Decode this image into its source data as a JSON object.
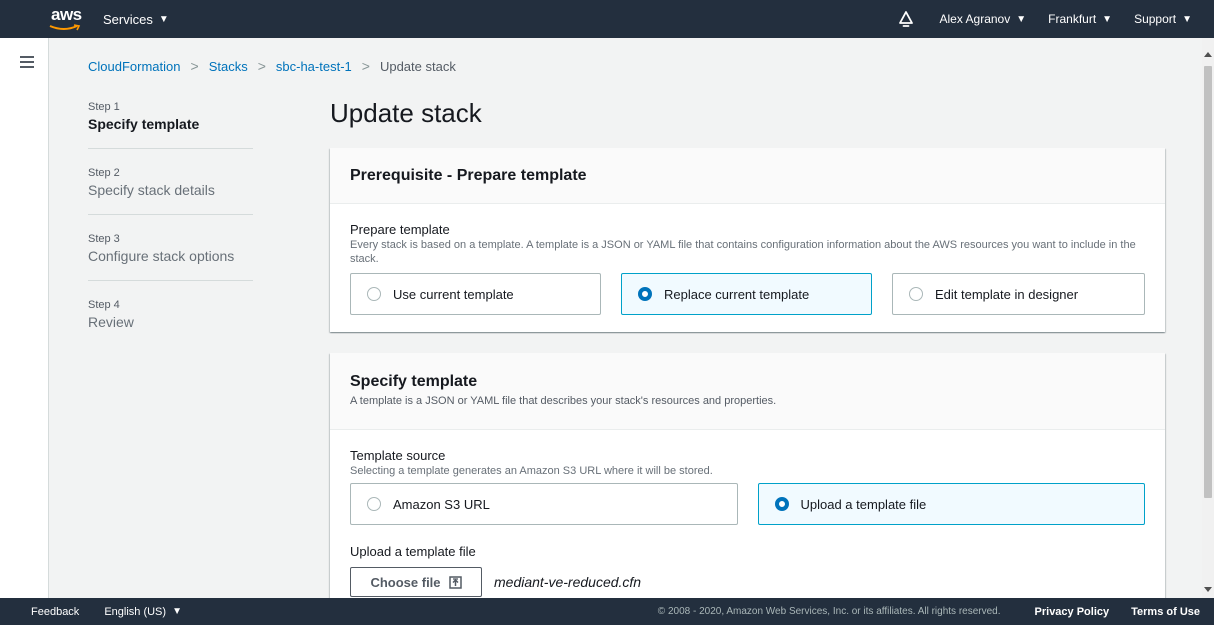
{
  "topnav": {
    "logo_text": "aws",
    "services_label": "Services",
    "user_label": "Alex Agranov",
    "region_label": "Frankfurt",
    "support_label": "Support"
  },
  "breadcrumb": {
    "items": [
      "CloudFormation",
      "Stacks",
      "sbc-ha-test-1"
    ],
    "current": "Update stack"
  },
  "steps": [
    {
      "num": "Step 1",
      "title": "Specify template"
    },
    {
      "num": "Step 2",
      "title": "Specify stack details"
    },
    {
      "num": "Step 3",
      "title": "Configure stack options"
    },
    {
      "num": "Step 4",
      "title": "Review"
    }
  ],
  "page_title": "Update stack",
  "prerequisite": {
    "heading": "Prerequisite - Prepare template",
    "label": "Prepare template",
    "description": "Every stack is based on a template. A template is a JSON or YAML file that contains configuration information about the AWS resources you want to include in the stack.",
    "options": [
      "Use current template",
      "Replace current template",
      "Edit template in designer"
    ],
    "selected": "Replace current template"
  },
  "specify": {
    "heading": "Specify template",
    "description": "A template is a JSON or YAML file that describes your stack's resources and properties.",
    "source_label": "Template source",
    "source_description": "Selecting a template generates an Amazon S3 URL where it will be stored.",
    "options": [
      "Amazon S3 URL",
      "Upload a template file"
    ],
    "selected": "Upload a template file",
    "upload_label": "Upload a template file",
    "choose_button": "Choose file",
    "file_name": "mediant-ve-reduced.cfn"
  },
  "footer": {
    "feedback": "Feedback",
    "language": "English (US)",
    "copyright": "© 2008 - 2020, Amazon Web Services, Inc. or its affiliates. All rights reserved.",
    "privacy": "Privacy Policy",
    "terms": "Terms of Use"
  },
  "colors": {
    "nav_bg": "#232f3e",
    "link": "#0073bb",
    "selected_border": "#00a1c9",
    "selected_bg": "#f1faff",
    "page_bg": "#f2f3f3"
  }
}
